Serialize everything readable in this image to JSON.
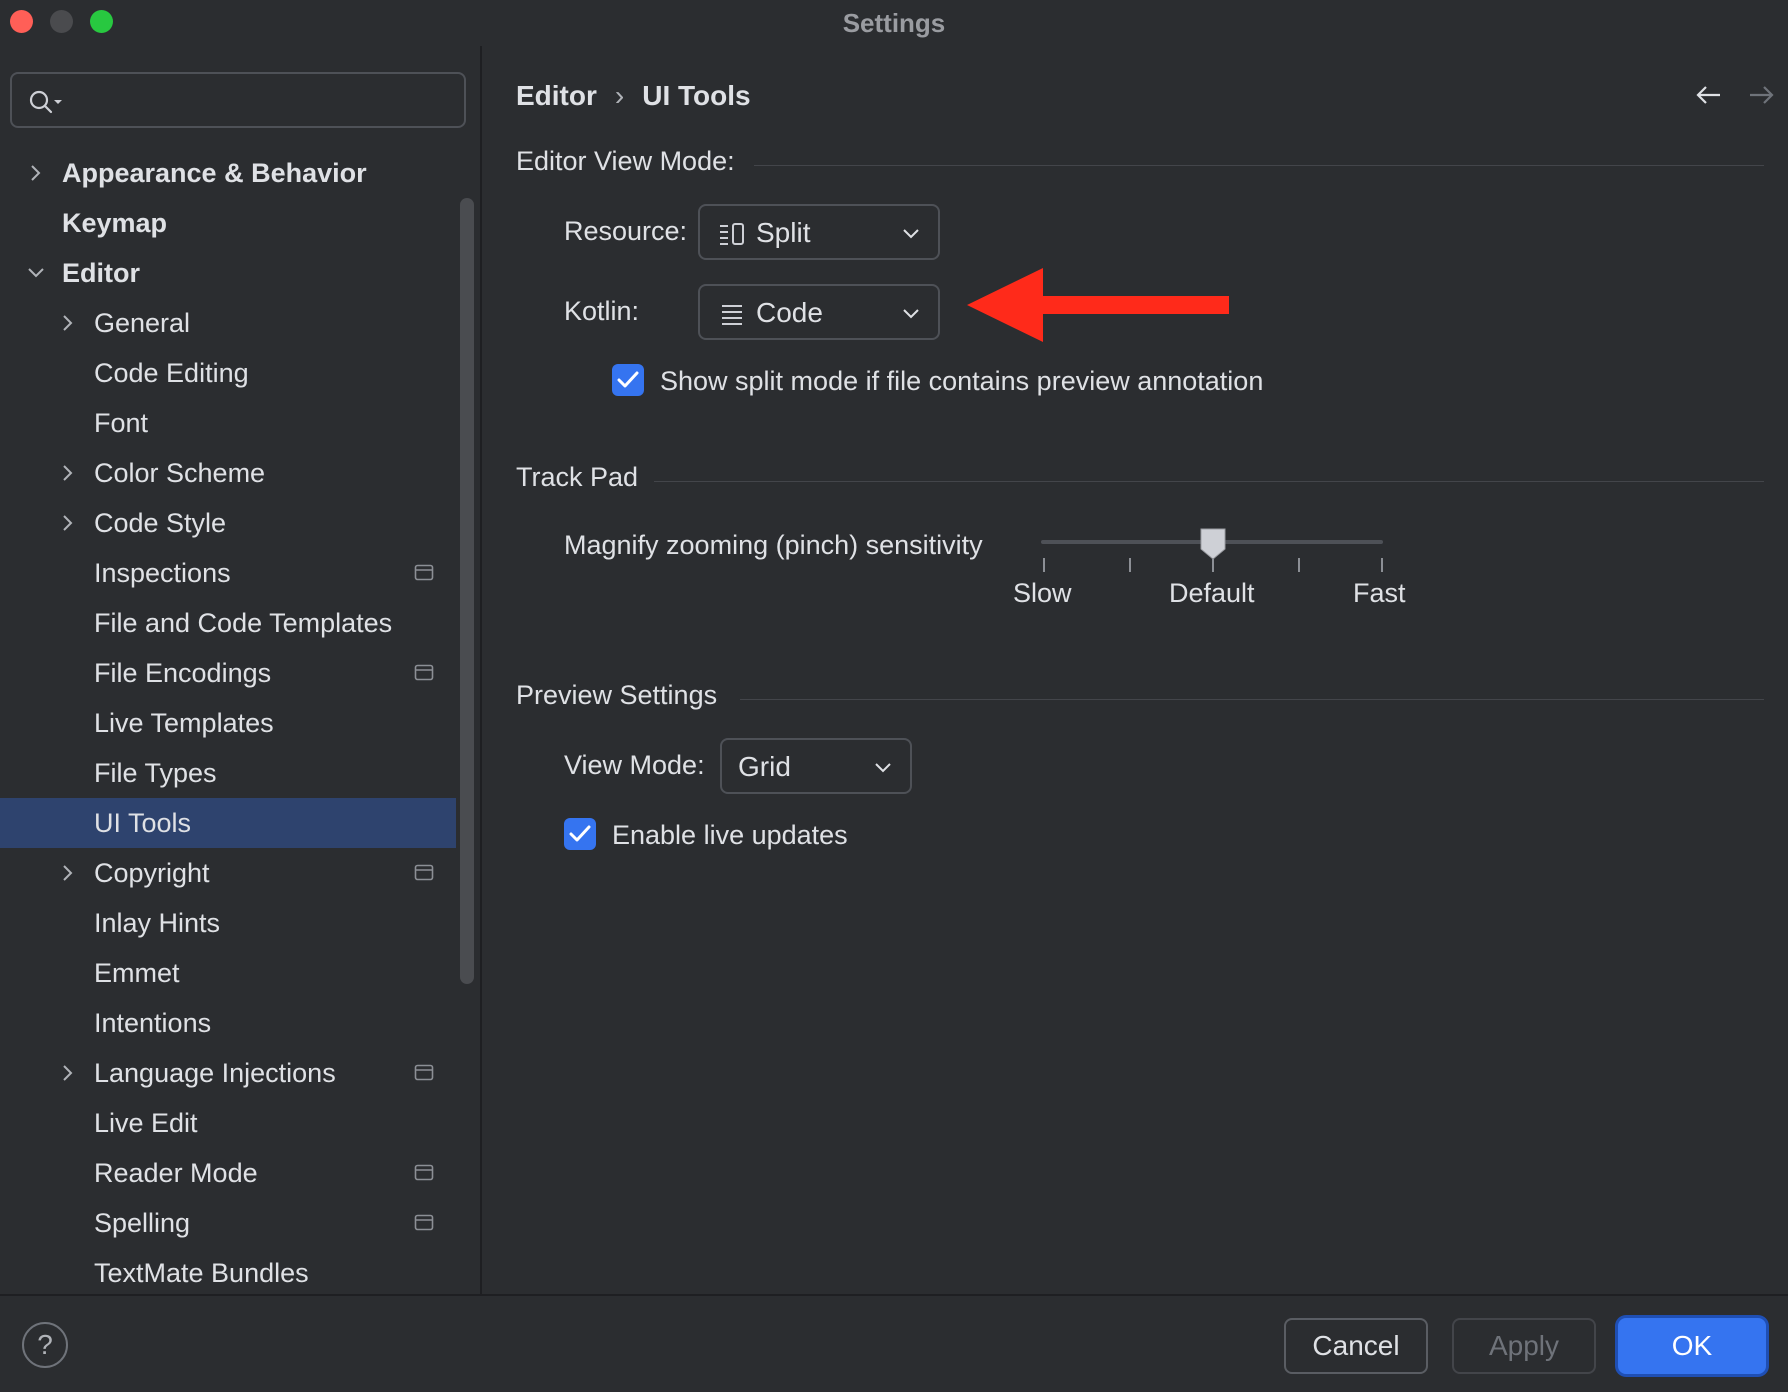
{
  "window": {
    "title": "Settings"
  },
  "search": {
    "placeholder": "",
    "icon": "search-icon"
  },
  "tree": [
    {
      "label": "Appearance & Behavior",
      "level": 0,
      "expandable": true,
      "expanded": false,
      "bold": true
    },
    {
      "label": "Keymap",
      "level": 0,
      "expandable": false,
      "bold": true
    },
    {
      "label": "Editor",
      "level": 0,
      "expandable": true,
      "expanded": true,
      "bold": true
    },
    {
      "label": "General",
      "level": 1,
      "expandable": true,
      "expanded": false
    },
    {
      "label": "Code Editing",
      "level": 1
    },
    {
      "label": "Font",
      "level": 1
    },
    {
      "label": "Color Scheme",
      "level": 1,
      "expandable": true,
      "expanded": false
    },
    {
      "label": "Code Style",
      "level": 1,
      "expandable": true,
      "expanded": false
    },
    {
      "label": "Inspections",
      "level": 1,
      "project": true
    },
    {
      "label": "File and Code Templates",
      "level": 1
    },
    {
      "label": "File Encodings",
      "level": 1,
      "project": true
    },
    {
      "label": "Live Templates",
      "level": 1
    },
    {
      "label": "File Types",
      "level": 1
    },
    {
      "label": "UI Tools",
      "level": 1,
      "selected": true
    },
    {
      "label": "Copyright",
      "level": 1,
      "expandable": true,
      "expanded": false,
      "project": true
    },
    {
      "label": "Inlay Hints",
      "level": 1
    },
    {
      "label": "Emmet",
      "level": 1
    },
    {
      "label": "Intentions",
      "level": 1
    },
    {
      "label": "Language Injections",
      "level": 1,
      "expandable": true,
      "expanded": false,
      "project": true
    },
    {
      "label": "Live Edit",
      "level": 1
    },
    {
      "label": "Reader Mode",
      "level": 1,
      "project": true
    },
    {
      "label": "Spelling",
      "level": 1,
      "project": true
    },
    {
      "label": "TextMate Bundles",
      "level": 1
    }
  ],
  "breadcrumb": {
    "parent": "Editor",
    "separator": "›",
    "current": "UI Tools"
  },
  "editor_view_mode": {
    "title": "Editor View Mode:",
    "resource_label": "Resource:",
    "resource_value": "Split",
    "resource_icon": "split-view-icon",
    "kotlin_label": "Kotlin:",
    "kotlin_value": "Code",
    "kotlin_icon": "code-view-icon",
    "split_checkbox_label": "Show split mode if file contains preview annotation",
    "split_checkbox_checked": true
  },
  "track_pad": {
    "title": "Track Pad",
    "magnify_label": "Magnify zooming (pinch) sensitivity",
    "slider_value": 0.5,
    "ticks": 5,
    "labels": {
      "slow": "Slow",
      "default": "Default",
      "fast": "Fast"
    }
  },
  "preview_settings": {
    "title": "Preview Settings",
    "view_mode_label": "View Mode:",
    "view_mode_value": "Grid",
    "live_updates_label": "Enable live updates",
    "live_updates_checked": true
  },
  "footer": {
    "help_label": "?",
    "cancel": "Cancel",
    "apply": "Apply",
    "ok": "OK"
  },
  "colors": {
    "accent": "#3574f0",
    "selection": "#2e436e",
    "arrow": "#ff2a1a",
    "background": "#2b2d30"
  }
}
